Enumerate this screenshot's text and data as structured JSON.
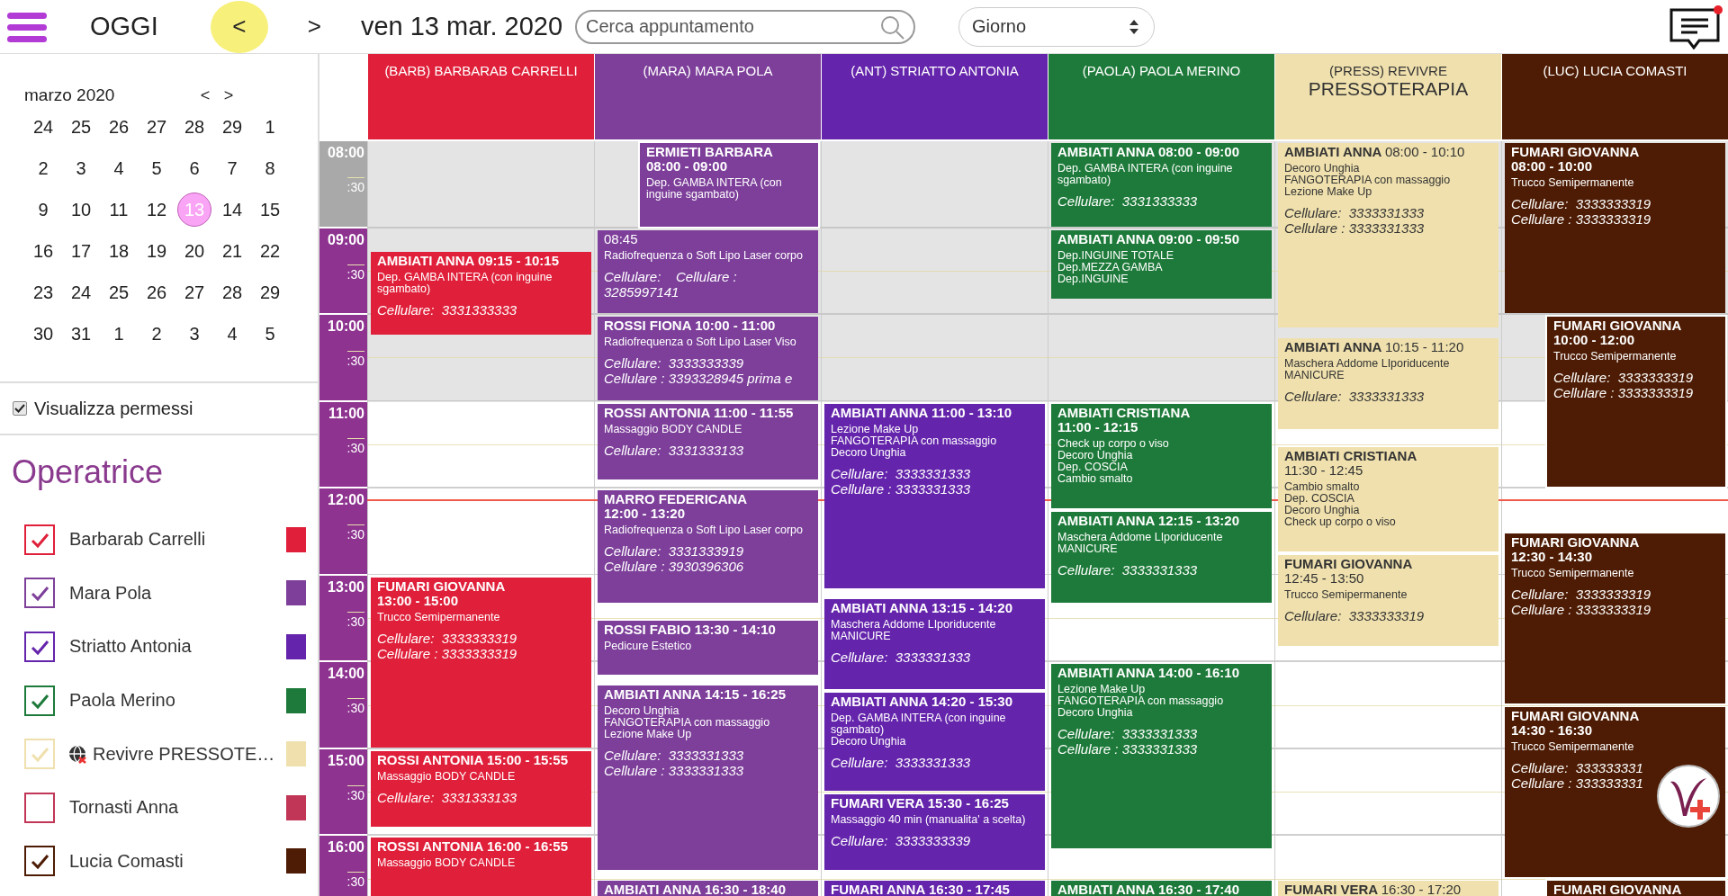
{
  "topbar": {
    "today": "OGGI",
    "prev": "<",
    "next": ">",
    "date": "ven 13 mar. 2020",
    "search": {
      "placeholder": "Cerca appuntamento"
    },
    "view": "Giorno",
    "notifications": {
      "unread": true
    }
  },
  "sidebar": {
    "mini_calendar": {
      "title": "marzo 2020",
      "prev": "<",
      "next": ">",
      "weeks": [
        [
          {
            "label": "24",
            "selected": false
          },
          {
            "label": "25",
            "selected": false
          },
          {
            "label": "26",
            "selected": false
          },
          {
            "label": "27",
            "selected": false
          },
          {
            "label": "28",
            "selected": false
          },
          {
            "label": "29",
            "selected": false
          },
          {
            "label": "1",
            "selected": false
          }
        ],
        [
          {
            "label": "2",
            "selected": false
          },
          {
            "label": "3",
            "selected": false
          },
          {
            "label": "4",
            "selected": false
          },
          {
            "label": "5",
            "selected": false
          },
          {
            "label": "6",
            "selected": false
          },
          {
            "label": "7",
            "selected": false
          },
          {
            "label": "8",
            "selected": false
          }
        ],
        [
          {
            "label": "9",
            "selected": false
          },
          {
            "label": "10",
            "selected": false
          },
          {
            "label": "11",
            "selected": false
          },
          {
            "label": "12",
            "selected": false
          },
          {
            "label": "13",
            "selected": true
          },
          {
            "label": "14",
            "selected": false
          },
          {
            "label": "15",
            "selected": false
          }
        ],
        [
          {
            "label": "16",
            "selected": false
          },
          {
            "label": "17",
            "selected": false
          },
          {
            "label": "18",
            "selected": false
          },
          {
            "label": "19",
            "selected": false
          },
          {
            "label": "20",
            "selected": false
          },
          {
            "label": "21",
            "selected": false
          },
          {
            "label": "22",
            "selected": false
          }
        ],
        [
          {
            "label": "23",
            "selected": false
          },
          {
            "label": "24",
            "selected": false
          },
          {
            "label": "25",
            "selected": false
          },
          {
            "label": "26",
            "selected": false
          },
          {
            "label": "27",
            "selected": false
          },
          {
            "label": "28",
            "selected": false
          },
          {
            "label": "29",
            "selected": false
          }
        ],
        [
          {
            "label": "30",
            "selected": false
          },
          {
            "label": "31",
            "selected": false
          },
          {
            "label": "1",
            "selected": false
          },
          {
            "label": "2",
            "selected": false
          },
          {
            "label": "3",
            "selected": false
          },
          {
            "label": "4",
            "selected": false
          },
          {
            "label": "5",
            "selected": false
          }
        ]
      ]
    },
    "show_permits": {
      "label": "Visualizza permessi",
      "checked": true
    },
    "operators_title": "Operatrice",
    "operators": [
      {
        "name": "Barbarab Carrelli",
        "color": "#e0203a",
        "checked": true,
        "kind": "staff"
      },
      {
        "name": "Mara Pola",
        "color": "#7d3f9a",
        "checked": true,
        "kind": "staff"
      },
      {
        "name": "Striatto Antonia",
        "color": "#6424ab",
        "checked": true,
        "kind": "staff"
      },
      {
        "name": "Paola Merino",
        "color": "#1e7a3a",
        "checked": true,
        "kind": "staff"
      },
      {
        "name": "Revivre PRESSOTE…",
        "color": "#efe0ad",
        "checked": true,
        "kind": "external"
      },
      {
        "name": "Tornasti Anna",
        "color": "#c13656",
        "checked": false,
        "kind": "staff"
      },
      {
        "name": "Lucia Comasti",
        "color": "#4e1c04",
        "checked": true,
        "kind": "staff"
      }
    ]
  },
  "schedule": {
    "hours": [
      {
        "label": "08:00",
        "half": ":30",
        "open": false,
        "shaded": true,
        "now": false
      },
      {
        "label": "09:00",
        "half": ":30",
        "open": true,
        "shaded": true,
        "now": false
      },
      {
        "label": "10:00",
        "half": ":30",
        "open": true,
        "shaded": true,
        "now": false
      },
      {
        "label": "11:00",
        "half": ":30",
        "open": true,
        "shaded": false,
        "now": false
      },
      {
        "label": "12:00",
        "half": ":30",
        "open": true,
        "shaded": false,
        "now": true
      },
      {
        "label": "13:00",
        "half": ":30",
        "open": true,
        "shaded": false,
        "now": false
      },
      {
        "label": "14:00",
        "half": ":30",
        "open": true,
        "shaded": false,
        "now": false
      },
      {
        "label": "15:00",
        "half": ":30",
        "open": true,
        "shaded": false,
        "now": false
      },
      {
        "label": "16:00",
        "half": ":30",
        "open": true,
        "shaded": false,
        "now": false
      }
    ],
    "columns": [
      {
        "title": "(BARB) BARBARAB CARRELLI",
        "color": "#e0203a",
        "appointments": [
          {
            "client": "AMBIATI ANNA",
            "time": "09:15 - 10:15",
            "overlap": false,
            "services": [
              "Dep. GAMBA INTERA (con inguine sgambato)"
            ],
            "phones": [
              "Cellulare:  3331333333"
            ]
          },
          {
            "client": "FUMARI GIOVANNA",
            "time": "13:00 - 15:00",
            "overlap": false,
            "services": [
              "Trucco Semipermanente"
            ],
            "phones": [
              "Cellulare:  3333333319",
              "Cellulare : 3333333319"
            ]
          },
          {
            "client": "ROSSI ANTONIA",
            "time": "15:00 - 15:55",
            "overlap": false,
            "services": [
              "Massaggio BODY CANDLE"
            ],
            "phones": [
              "Cellulare:  3331333133"
            ]
          },
          {
            "client": "ROSSI ANTONIA",
            "time": "16:00 - 16:55",
            "overlap": false,
            "services": [
              "Massaggio BODY CANDLE"
            ]
          }
        ]
      },
      {
        "title": "(MARA) MARA POLA",
        "color": "#7d3f9a",
        "appointments": [
          {
            "client": "ERMIETI BARBARA",
            "time": "08:00 - 09:00",
            "overlap": true,
            "services": [
              "Dep. GAMBA INTERA (con inguine sgambato)"
            ]
          },
          {
            "time": "08:45",
            "overlap": false,
            "services": [
              "Radiofrequenza o Soft Lipo Laser corpo"
            ],
            "phones": [
              "Cellulare:    Cellulare : 3285997141"
            ]
          },
          {
            "client": "ROSSI FIONA",
            "time": "10:00 - 11:00",
            "overlap": false,
            "services": [
              "Radiofrequenza o Soft Lipo Laser Viso"
            ],
            "phones": [
              "Cellulare:  3333333339",
              "Cellulare : 3393328945 prima e"
            ]
          },
          {
            "client": "ROSSI ANTONIA",
            "time": "11:00 - 11:55",
            "overlap": false,
            "services": [
              "Massaggio BODY CANDLE"
            ],
            "phones": [
              "Cellulare:  3331333133"
            ]
          },
          {
            "client": "MARRO FEDERICANA",
            "time": "12:00 - 13:20",
            "overlap": false,
            "services": [
              "Radiofrequenza o Soft Lipo Laser corpo"
            ],
            "phones": [
              "Cellulare:  3331333919",
              "Cellulare : 3930396306"
            ]
          },
          {
            "client": "ROSSI FABIO",
            "time": "13:30 - 14:10",
            "overlap": false,
            "services": [
              "Pedicure Estetico"
            ]
          },
          {
            "client": "AMBIATI ANNA",
            "time": "14:15 - 16:25",
            "overlap": false,
            "services": [
              "Decoro Unghia",
              "FANGOTERAPIA con massaggio",
              "Lezione Make Up"
            ],
            "phones": [
              "Cellulare:  3333331333",
              "Cellulare : 3333331333"
            ]
          },
          {
            "client": "AMBIATI ANNA",
            "time": "16:30 - 18:40",
            "overlap": false
          }
        ]
      },
      {
        "title": "(ANT) STRIATTO ANTONIA",
        "color": "#6424ab",
        "appointments": [
          {
            "client": "AMBIATI ANNA",
            "time": "11:00 - 13:10",
            "overlap": false,
            "services": [
              "Lezione Make Up",
              "FANGOTERAPIA con massaggio",
              "Decoro Unghia"
            ],
            "phones": [
              "Cellulare:  3333331333",
              "Cellulare : 3333331333"
            ]
          },
          {
            "client": "AMBIATI ANNA",
            "time": "13:15 - 14:20",
            "overlap": false,
            "services": [
              "Maschera Addome LIporiducente",
              "MANICURE"
            ],
            "phones": [
              "Cellulare:  3333331333"
            ]
          },
          {
            "client": "AMBIATI ANNA",
            "time": "14:20 - 15:30",
            "overlap": false,
            "services": [
              "Dep. GAMBA INTERA (con inguine sgambato)",
              "Decoro Unghia"
            ],
            "phones": [
              "Cellulare:  3333331333"
            ]
          },
          {
            "client": "FUMARI VERA",
            "time": "15:30 - 16:25",
            "overlap": false,
            "services": [
              "Massaggio 40 min (manualita' a scelta)"
            ],
            "phones": [
              "Cellulare:  3333333339"
            ]
          },
          {
            "client": "FUMARI ANNA",
            "time": "16:30 - 17:45",
            "overlap": false
          }
        ]
      },
      {
        "title": "(PAOLA) PAOLA MERINO",
        "color": "#1e7a3a",
        "appointments": [
          {
            "client": "AMBIATI ANNA",
            "time": "08:00 - 09:00",
            "overlap": false,
            "services": [
              "Dep. GAMBA INTERA (con inguine sgambato)"
            ],
            "phones": [
              "Cellulare:  3331333333"
            ]
          },
          {
            "client": "AMBIATI ANNA",
            "time": "09:00 - 09:50",
            "overlap": false,
            "services": [
              "Dep.INGUINE TOTALE",
              "Dep.MEZZA GAMBA",
              "Dep.INGUINE"
            ]
          },
          {
            "client": "AMBIATI CRISTIANA",
            "time": "11:00 - 12:15",
            "overlap": false,
            "services": [
              "Check up corpo o viso",
              "Decoro Unghia",
              "Dep. COSCIA",
              "Cambio smalto"
            ]
          },
          {
            "client": "AMBIATI ANNA",
            "time": "12:15 - 13:20",
            "overlap": false,
            "services": [
              "Maschera Addome LIporiducente",
              "MANICURE"
            ],
            "phones": [
              "Cellulare:  3333331333"
            ]
          },
          {
            "client": "AMBIATI ANNA",
            "time": "14:00 - 16:10",
            "overlap": false,
            "services": [
              "Lezione Make Up",
              "FANGOTERAPIA con massaggio",
              "Decoro Unghia"
            ],
            "phones": [
              "Cellulare:  3333331333",
              "Cellulare : 3333331333"
            ]
          },
          {
            "client": "AMBIATI ANNA",
            "time": "16:30 - 17:40",
            "overlap": false
          }
        ]
      },
      {
        "title": "(PRESS) REVIVRE",
        "subtitle": "PRESSOTERAPIA",
        "color": "#efe0ad",
        "appointments": [
          {
            "client": "AMBIATI ANNA",
            "time": "08:00 - 10:10",
            "overlap": false,
            "services": [
              "Decoro Unghia",
              "FANGOTERAPIA con massaggio",
              "Lezione Make Up"
            ],
            "phones": [
              "Cellulare:  3333331333",
              "Cellulare : 3333331333"
            ]
          },
          {
            "client": "AMBIATI ANNA",
            "time": "10:15 - 11:20",
            "overlap": false,
            "services": [
              "Maschera Addome LIporiducente",
              "MANICURE"
            ],
            "phones": [
              "Cellulare:  3333331333"
            ]
          },
          {
            "client": "AMBIATI CRISTIANA",
            "time": "11:30 - 12:45",
            "overlap": false,
            "services": [
              "Cambio smalto",
              "Dep. COSCIA",
              "Decoro Unghia",
              "Check up corpo o viso"
            ]
          },
          {
            "client": "FUMARI GIOVANNA",
            "time": "12:45 - 13:50",
            "overlap": false,
            "services": [
              "Trucco Semipermanente"
            ],
            "phones": [
              "Cellulare:  3333333319"
            ]
          },
          {
            "client": "FUMARI VERA",
            "time": "16:30 - 17:20",
            "overlap": false
          }
        ]
      },
      {
        "title": "(LUC) LUCIA COMASTI",
        "color": "#4e1c04",
        "appointments": [
          {
            "client": "FUMARI GIOVANNA",
            "time": "08:00 - 10:00",
            "overlap": false,
            "services": [
              "Trucco Semipermanente"
            ],
            "phones": [
              "Cellulare:  3333333319",
              "Cellulare : 3333333319"
            ]
          },
          {
            "client": "FUMARI GIOVANNA",
            "time": "10:00 - 12:00",
            "overlap": true,
            "services": [
              "Trucco Semipermanente"
            ],
            "phones": [
              "Cellulare:  3333333319",
              "Cellulare : 3333333319"
            ]
          },
          {
            "client": "FUMARI GIOVANNA",
            "time": "12:30 - 14:30",
            "overlap": false,
            "services": [
              "Trucco Semipermanente"
            ],
            "phones": [
              "Cellulare:  3333333319",
              "Cellulare : 3333333319"
            ]
          },
          {
            "client": "FUMARI GIOVANNA",
            "time": "14:30 - 16:30",
            "overlap": false,
            "services": [
              "Trucco Semipermanente"
            ],
            "phones": [
              "Cellulare:  333333331",
              "Cellulare : 333333331"
            ]
          },
          {
            "client": "FUMARI GIOVANNA",
            "overlap": true
          }
        ]
      }
    ]
  }
}
